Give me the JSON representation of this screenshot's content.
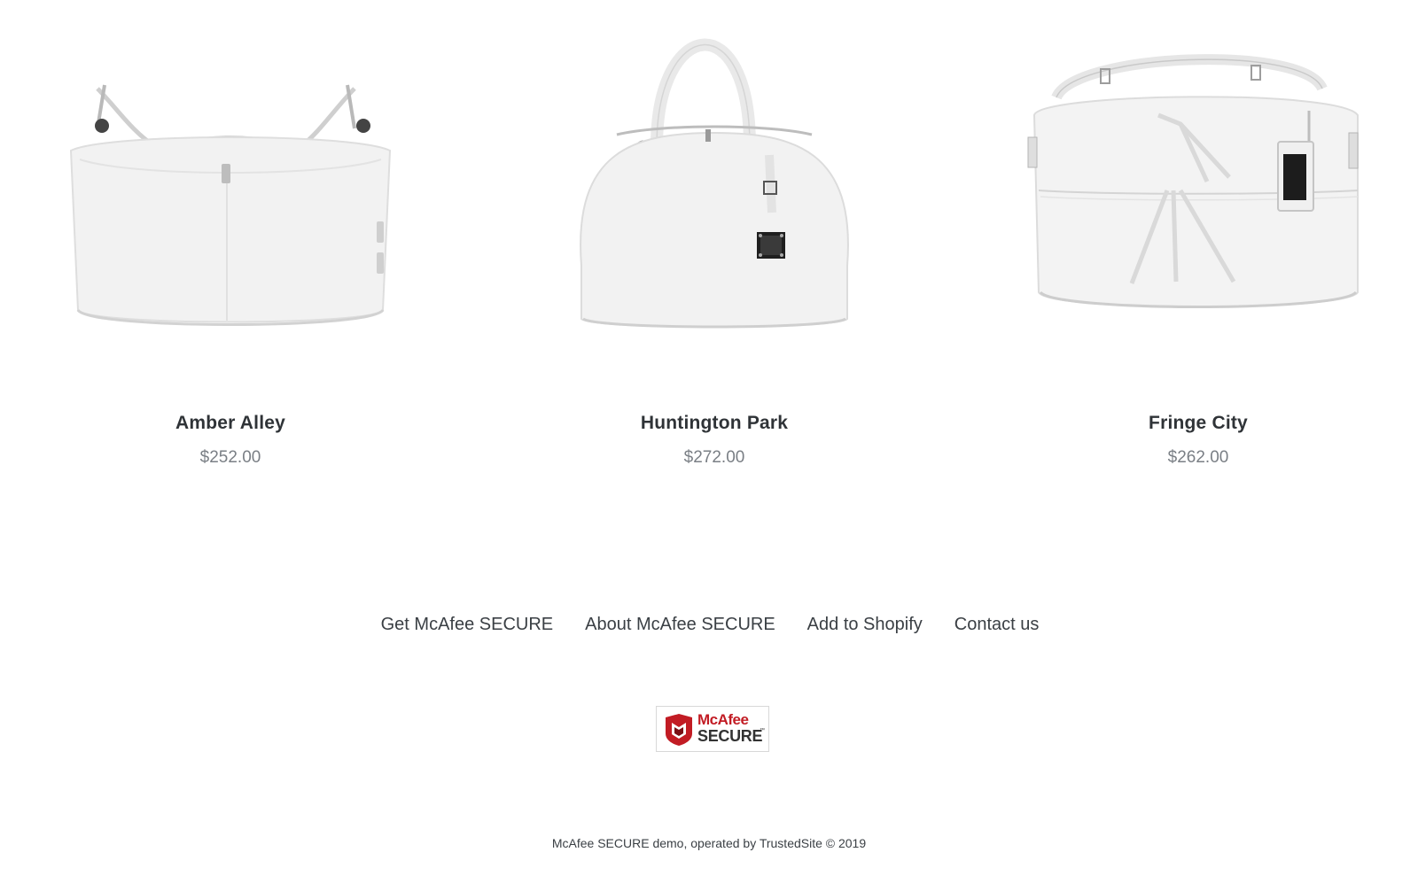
{
  "products": [
    {
      "title": "Amber Alley",
      "price": "$252.00",
      "image_icon": "white-hobo-bag-icon"
    },
    {
      "title": "Huntington Park",
      "price": "$272.00",
      "image_icon": "white-dome-satchel-icon"
    },
    {
      "title": "Fringe City",
      "price": "$262.00",
      "image_icon": "white-shoulder-bag-icon"
    }
  ],
  "footer": {
    "links": [
      "Get McAfee SECURE",
      "About McAfee SECURE",
      "Add to Shopify",
      "Contact us"
    ],
    "badge": {
      "brand": "McAfee",
      "secure": "SECURE",
      "tm": "™"
    },
    "copyright": "McAfee SECURE demo, operated by TrustedSite © 2019"
  },
  "colors": {
    "text": "#2f3337",
    "price": "#7a7f85",
    "badge_red": "#c21c24",
    "bag_white": "#f2f2f2"
  }
}
